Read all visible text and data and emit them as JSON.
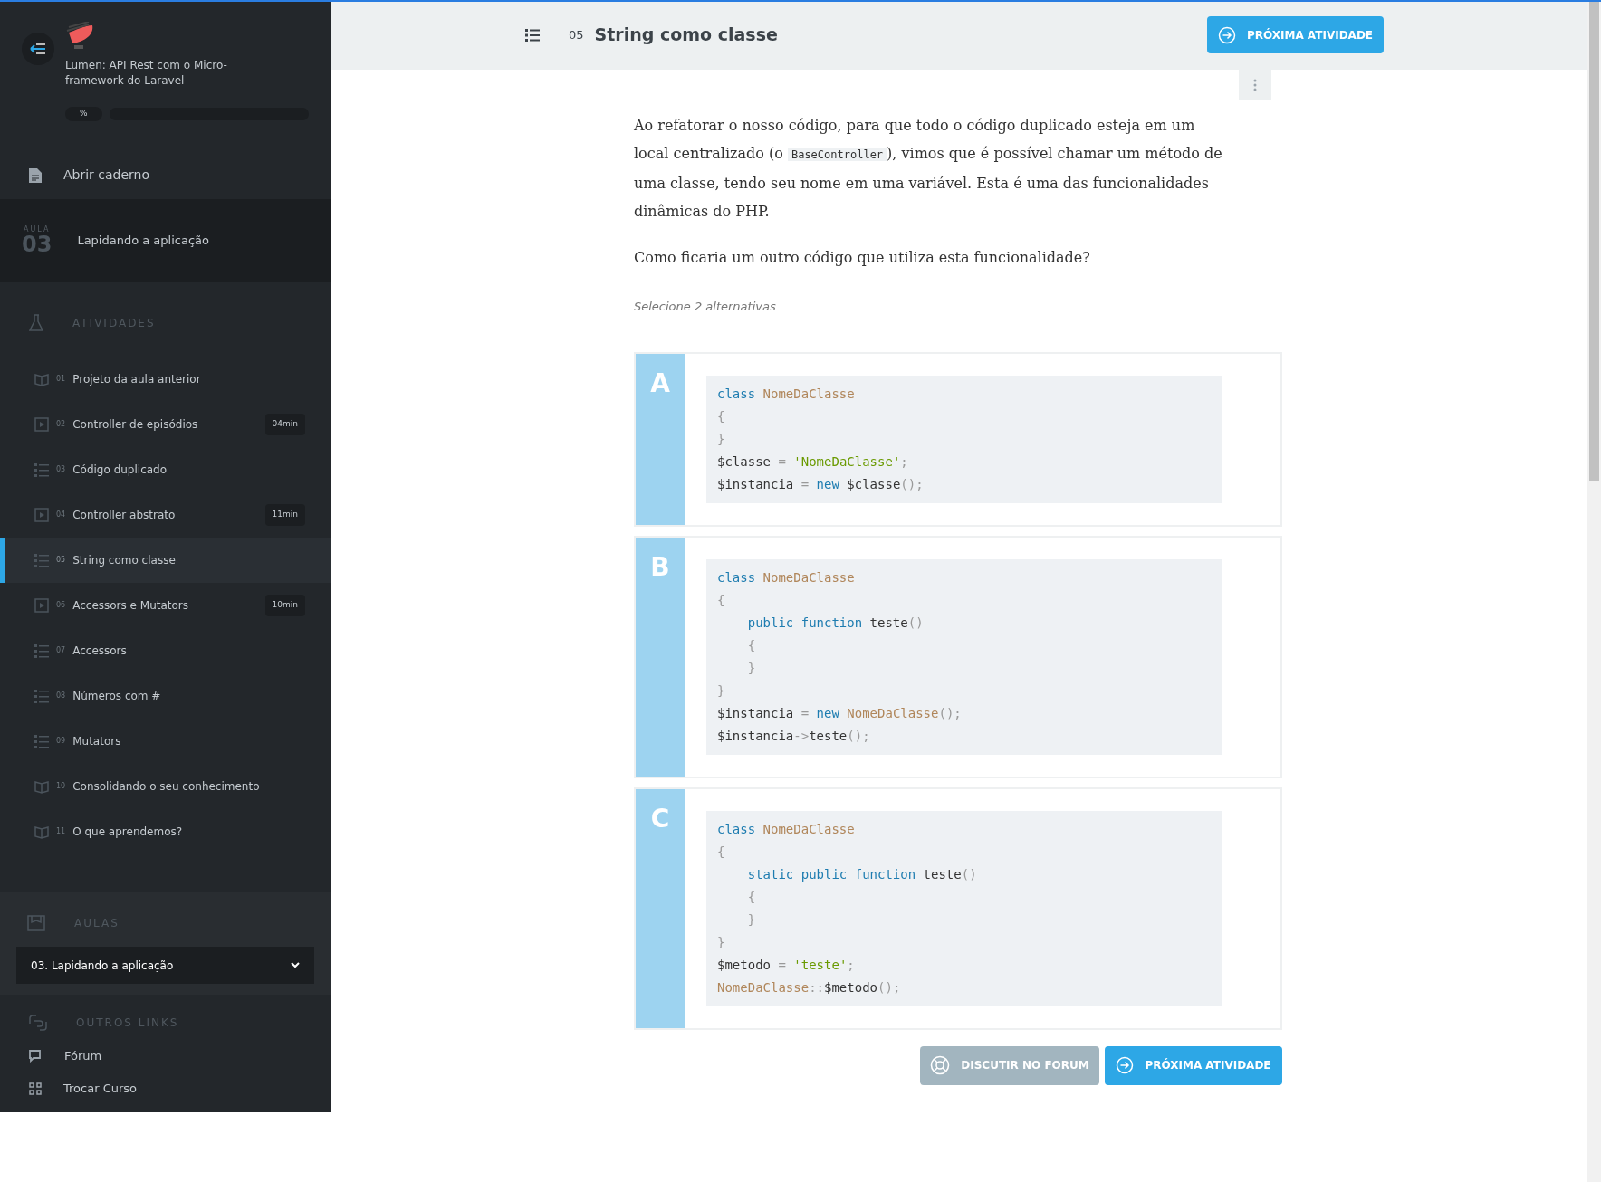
{
  "course": {
    "title": "Lumen: API Rest com o Micro-framework do Laravel",
    "progress_label": "%",
    "level": 0
  },
  "notebook": {
    "label": "Abrir caderno"
  },
  "lesson": {
    "caption": "AULA",
    "number": "03",
    "title": "Lapidando a aplicação"
  },
  "activities": {
    "heading": "ATIVIDADES",
    "items": [
      {
        "kind": "reading",
        "number": "01",
        "title": "Projeto da aula anterior",
        "selected": false
      },
      {
        "kind": "video",
        "number": "02",
        "title": "Controller de episódios",
        "duration": "04min",
        "selected": false
      },
      {
        "kind": "list",
        "number": "03",
        "title": "Código duplicado",
        "selected": false
      },
      {
        "kind": "video",
        "number": "04",
        "title": "Controller abstrato",
        "duration": "11min",
        "selected": false
      },
      {
        "kind": "list",
        "number": "05",
        "title": "String como classe",
        "selected": true
      },
      {
        "kind": "video",
        "number": "06",
        "title": "Accessors e Mutators",
        "duration": "10min",
        "selected": false
      },
      {
        "kind": "list",
        "number": "07",
        "title": "Accessors",
        "selected": false
      },
      {
        "kind": "list",
        "number": "08",
        "title": "Números com #",
        "selected": false
      },
      {
        "kind": "list",
        "number": "09",
        "title": "Mutators",
        "selected": false
      },
      {
        "kind": "reading",
        "number": "10",
        "title": "Consolidando o seu conhecimento",
        "selected": false
      },
      {
        "kind": "reading",
        "number": "11",
        "title": "O que aprendemos?",
        "selected": false
      }
    ]
  },
  "lessons": {
    "heading": "AULAS",
    "select_value": "03. Lapidando a aplicação"
  },
  "other_links": {
    "heading": "OUTROS LINKS",
    "items": [
      {
        "kind": "forum",
        "label": "Fórum"
      },
      {
        "kind": "switch",
        "label": "Trocar Curso"
      }
    ]
  },
  "header": {
    "number": "05",
    "title": "String como classe",
    "next_button": "PRÓXIMA ATIVIDADE"
  },
  "question": {
    "paragraph_before": "Ao refatorar o nosso código, para que todo o código duplicado esteja em um local centralizado (o",
    "inline_code": "BaseController",
    "paragraph_after": "), vimos que é possível chamar um método de uma classe, tendo seu nome em uma variável. Esta é uma das funcionalidades dinâmicas do PHP.",
    "prompt": "Como ficaria um outro código que utiliza esta funcionalidade?",
    "hint": "Selecione 2 alternativas"
  },
  "options": [
    {
      "letter": "A",
      "lines": [
        [
          {
            "kind": "keyword",
            "text": "class"
          },
          {
            "kind": "class",
            "text": " NomeDaClasse"
          }
        ],
        [
          {
            "kind": "punct",
            "text": "{"
          }
        ],
        [
          {
            "kind": "punct",
            "text": "}"
          }
        ],
        [
          {
            "kind": "plain",
            "text": "$classe"
          },
          {
            "kind": "punct",
            "text": " ="
          },
          {
            "kind": "string",
            "text": " 'NomeDaClasse'"
          },
          {
            "kind": "punct",
            "text": ";"
          }
        ],
        [
          {
            "kind": "plain",
            "text": "$instancia"
          },
          {
            "kind": "punct",
            "text": " ="
          },
          {
            "kind": "keyword",
            "text": " new"
          },
          {
            "kind": "plain",
            "text": " $classe"
          },
          {
            "kind": "punct",
            "text": "();"
          }
        ]
      ]
    },
    {
      "letter": "B",
      "lines": [
        [
          {
            "kind": "keyword",
            "text": "class"
          },
          {
            "kind": "class",
            "text": " NomeDaClasse"
          }
        ],
        [
          {
            "kind": "punct",
            "text": "{"
          }
        ],
        [
          {
            "kind": "keyword",
            "text": "    public function"
          },
          {
            "kind": "plain",
            "text": " teste"
          },
          {
            "kind": "punct",
            "text": "()"
          }
        ],
        [
          {
            "kind": "punct",
            "text": "    {"
          }
        ],
        [
          {
            "kind": "punct",
            "text": "    }"
          }
        ],
        [
          {
            "kind": "punct",
            "text": "}"
          }
        ],
        [
          {
            "kind": "plain",
            "text": "$instancia"
          },
          {
            "kind": "punct",
            "text": " ="
          },
          {
            "kind": "keyword",
            "text": " new"
          },
          {
            "kind": "class",
            "text": " NomeDaClasse"
          },
          {
            "kind": "punct",
            "text": "();"
          }
        ],
        [
          {
            "kind": "plain",
            "text": "$instancia"
          },
          {
            "kind": "punct",
            "text": "->"
          },
          {
            "kind": "plain",
            "text": "teste"
          },
          {
            "kind": "punct",
            "text": "();"
          }
        ]
      ]
    },
    {
      "letter": "C",
      "lines": [
        [
          {
            "kind": "keyword",
            "text": "class"
          },
          {
            "kind": "class",
            "text": " NomeDaClasse"
          }
        ],
        [
          {
            "kind": "punct",
            "text": "{"
          }
        ],
        [
          {
            "kind": "keyword",
            "text": "    static public function"
          },
          {
            "kind": "plain",
            "text": " teste"
          },
          {
            "kind": "punct",
            "text": "()"
          }
        ],
        [
          {
            "kind": "punct",
            "text": "    {"
          }
        ],
        [
          {
            "kind": "punct",
            "text": "    }"
          }
        ],
        [
          {
            "kind": "punct",
            "text": "}"
          }
        ],
        [
          {
            "kind": "plain",
            "text": "$metodo"
          },
          {
            "kind": "punct",
            "text": " ="
          },
          {
            "kind": "string",
            "text": " 'teste'"
          },
          {
            "kind": "punct",
            "text": ";"
          }
        ],
        [
          {
            "kind": "class",
            "text": "NomeDaClasse"
          },
          {
            "kind": "punct",
            "text": "::"
          },
          {
            "kind": "plain",
            "text": "$metodo"
          },
          {
            "kind": "punct",
            "text": "();"
          }
        ]
      ]
    }
  ],
  "footer": {
    "forum_button": "DISCUTIR NO FORUM",
    "next_button": "PRÓXIMA ATIVIDADE"
  }
}
